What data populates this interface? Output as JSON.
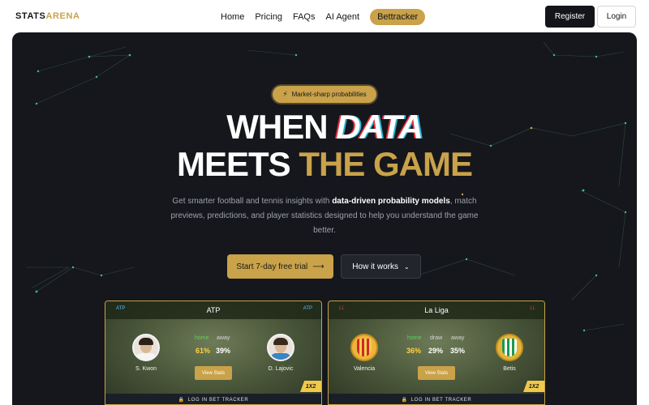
{
  "brand": {
    "logo_left": "STATS",
    "logo_right": "ARENA",
    "accent": "#c9a24a"
  },
  "nav": {
    "links": [
      "Home",
      "Pricing",
      "FAQs",
      "AI Agent"
    ],
    "pill": "Bettracker",
    "register": "Register",
    "login": "Login"
  },
  "hero": {
    "badge": "Market-sharp probabilities",
    "line1_a": "WHEN",
    "line1_b": "DATA",
    "line2_a": "MEETS",
    "line2_b": "THE GAME",
    "sub_a": "Get smarter football and tennis insights with",
    "sub_b": "data-driven probability models",
    "sub_c": ", match previews, predictions, and player statistics designed to help you understand the game better.",
    "cta_primary": "Start 7-day free trial",
    "cta_secondary": "How it works"
  },
  "cards": [
    {
      "league": "ATP",
      "home_player": "S. Kwon",
      "away_player": "D. Lajovic",
      "home_label": "home",
      "away_label": "away",
      "home_pct": "61%",
      "away_pct": "39%",
      "view": "View Stats",
      "tag": "1X2",
      "footer": "LOG IN BET TRACKER"
    },
    {
      "league": "La Liga",
      "home_player": "Valencia",
      "away_player": "Betis",
      "home_label": "home",
      "draw_label": "draw",
      "away_label": "away",
      "home_pct": "36%",
      "draw_pct": "29%",
      "away_pct": "35%",
      "view": "View Stats",
      "tag": "1X2",
      "footer": "LOG IN BET TRACKER"
    }
  ]
}
